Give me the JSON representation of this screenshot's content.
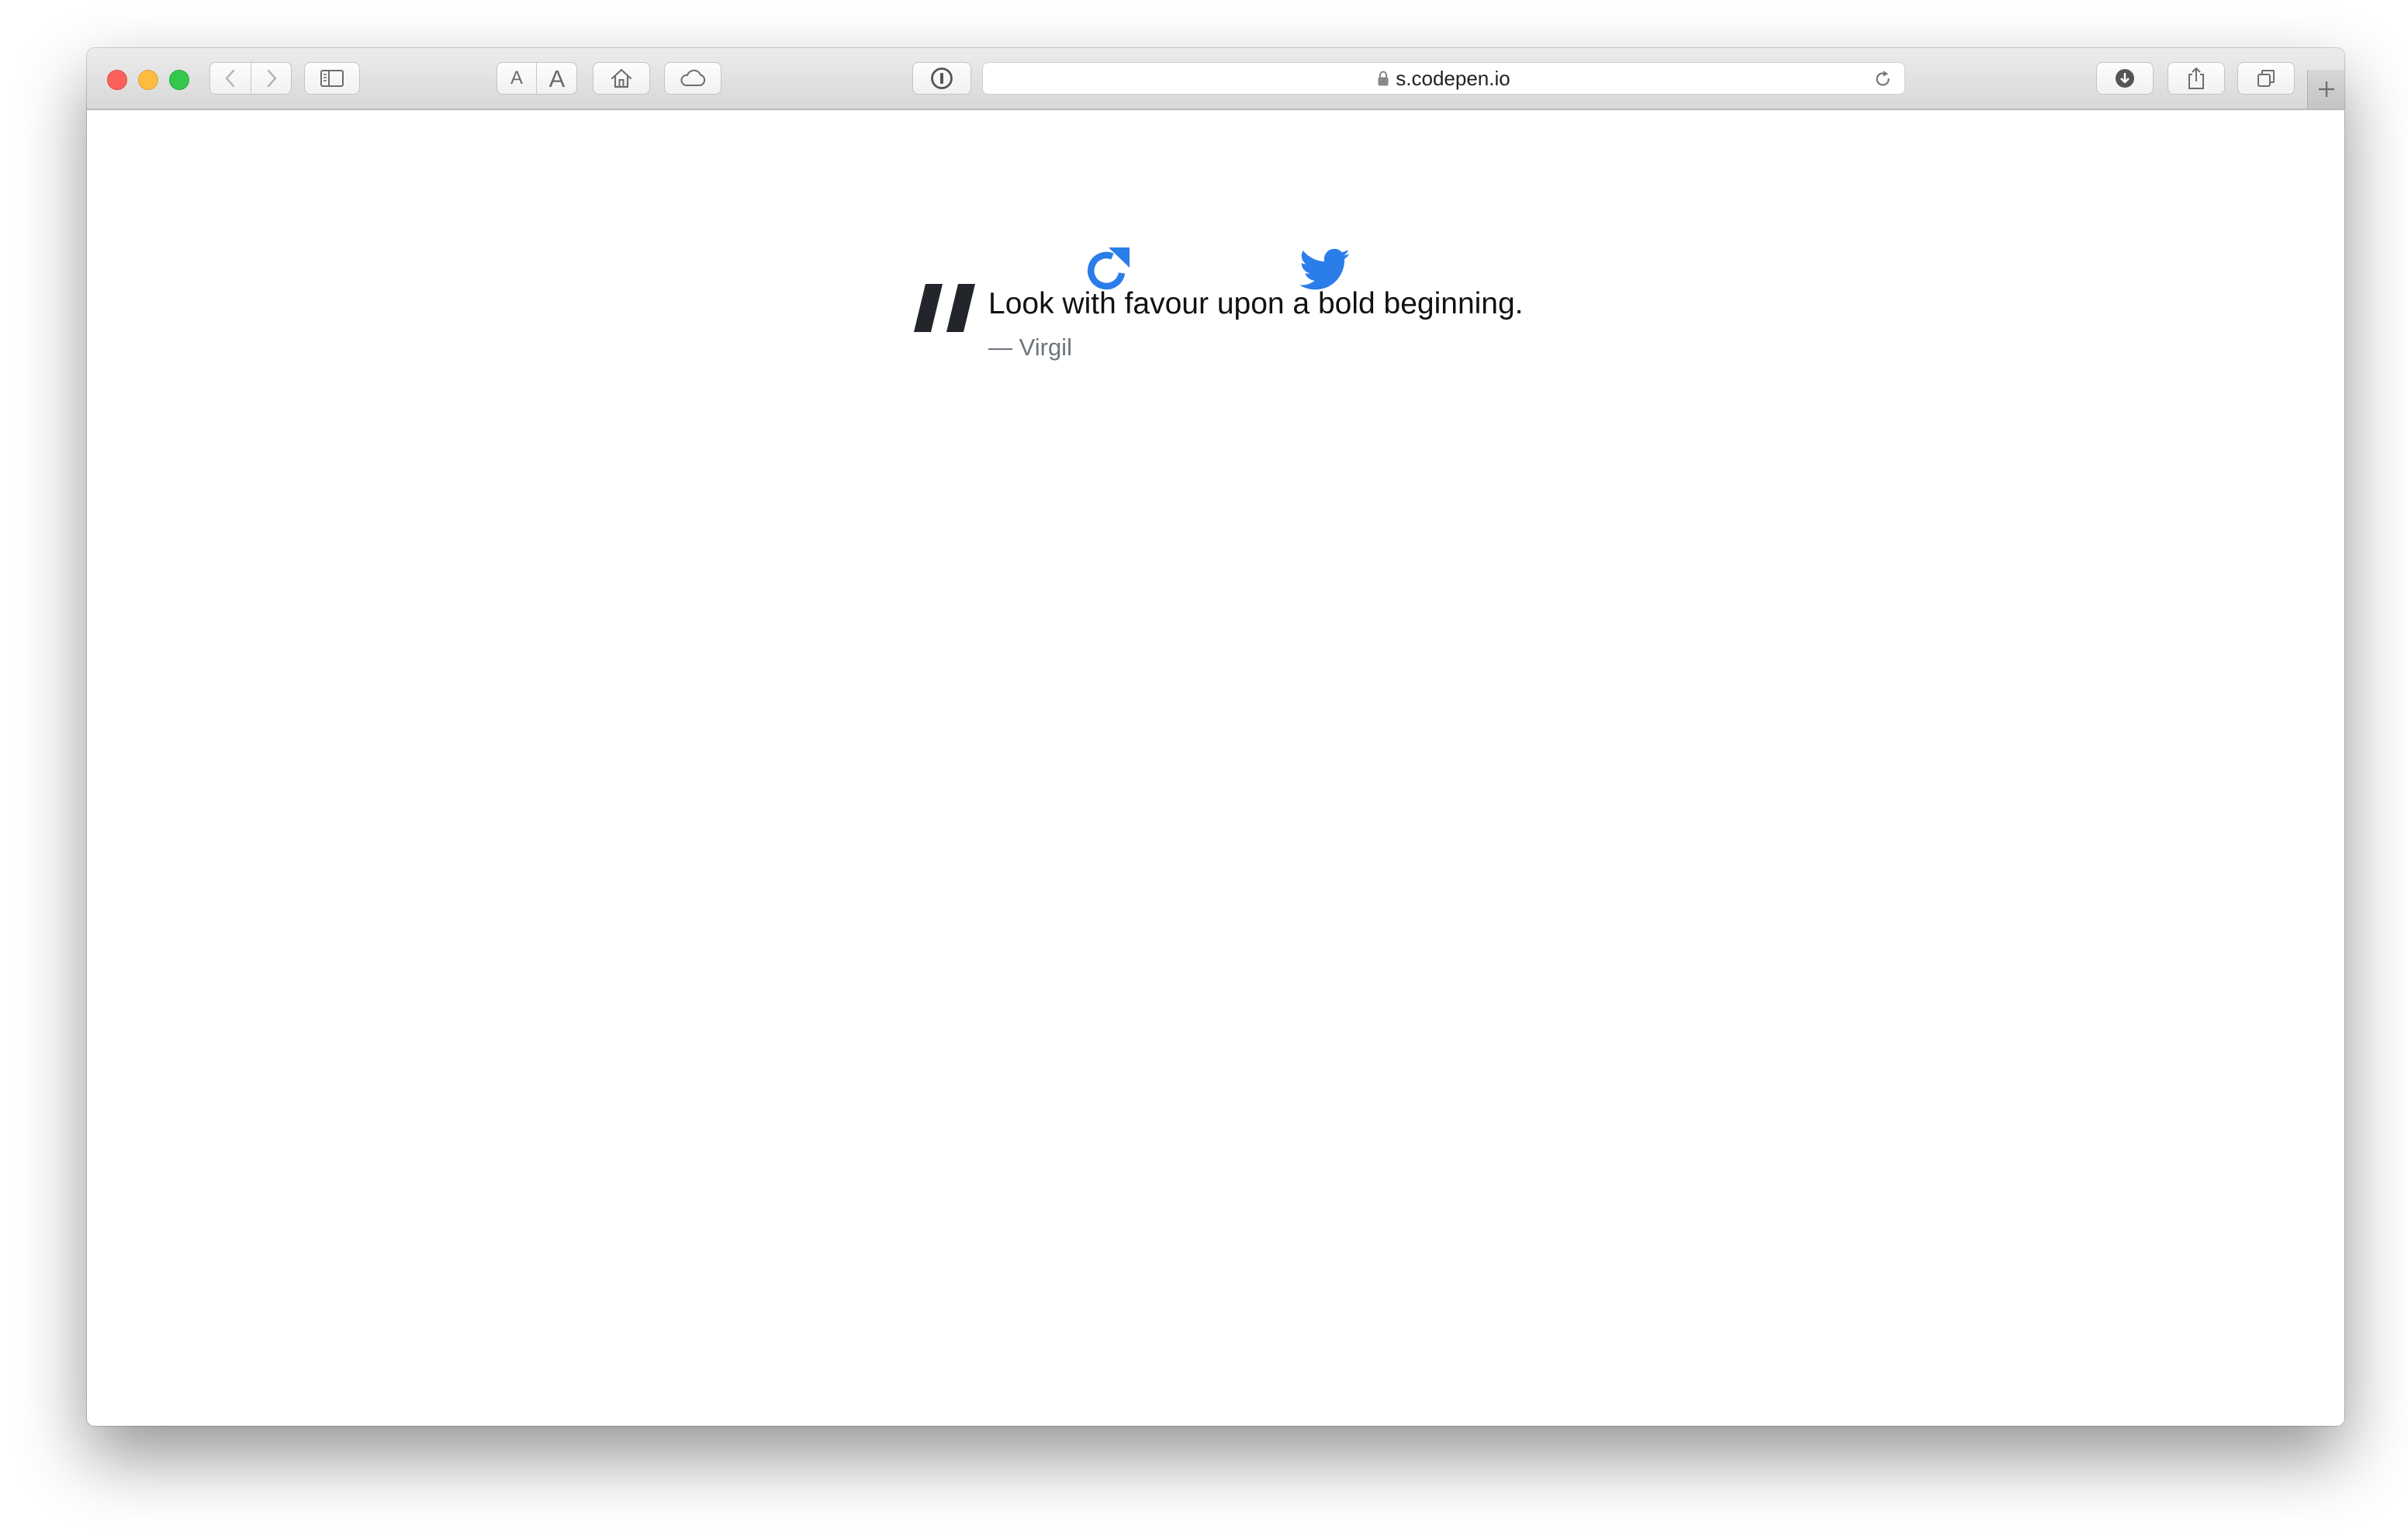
{
  "browser": {
    "url": "s.codepen.io",
    "text_size_small_label": "A",
    "text_size_large_label": "A",
    "window_controls": {
      "close_color": "#fc605c",
      "minimize_color": "#fdbc40",
      "maximize_color": "#34c84a"
    },
    "toolbar_icons": [
      "back-icon",
      "forward-icon",
      "sidebar-icon",
      "home-icon",
      "icloud-icon",
      "password-icon",
      "lock-icon",
      "reload-icon",
      "download-icon",
      "share-icon",
      "tabs-overview-icon",
      "plus-icon"
    ]
  },
  "page": {
    "quote": "Look with favour upon a bold beginning.",
    "author": "— Virgil",
    "accent_color": "#2b7de9",
    "icons": [
      "new-quote-icon",
      "twitter-icon",
      "quote-mark-icon"
    ]
  }
}
